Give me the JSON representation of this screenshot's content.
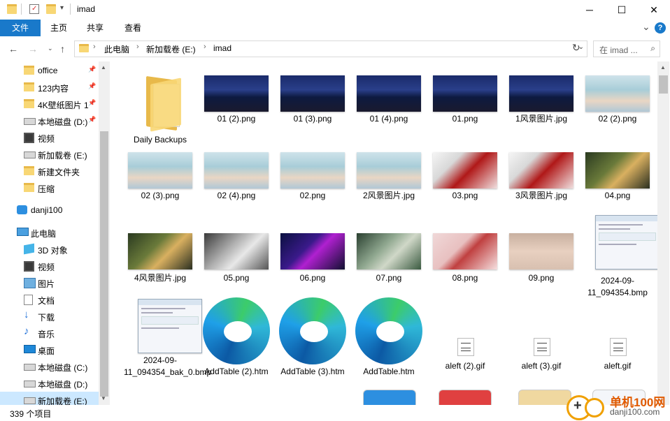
{
  "window": {
    "title": "imad",
    "minimize": "─",
    "maximize": "☐",
    "close": "✕"
  },
  "ribbon": {
    "tabs": [
      "文件",
      "主页",
      "共享",
      "查看"
    ],
    "expand": "⌄",
    "help": "?"
  },
  "address": {
    "crumbs": [
      "此电脑",
      "新加载卷 (E:)",
      "imad"
    ],
    "search_placeholder": "在 imad ...",
    "dropdown": "⌄",
    "refresh": "↻"
  },
  "sidebar": {
    "quick": [
      {
        "label": "office",
        "icon": "folder-icon",
        "pinned": true
      },
      {
        "label": "123内容",
        "icon": "folder-icon",
        "pinned": true
      },
      {
        "label": "4K壁纸图片 1",
        "icon": "folder-icon",
        "pinned": true
      },
      {
        "label": "本地磁盘 (D:)",
        "icon": "drive-icon",
        "pinned": true
      },
      {
        "label": "视频",
        "icon": "video-icon",
        "pinned": false
      },
      {
        "label": "新加载卷 (E:)",
        "icon": "drive-icon",
        "pinned": false
      },
      {
        "label": "新建文件夹",
        "icon": "folder-icon",
        "pinned": false
      },
      {
        "label": "压缩",
        "icon": "folder-icon",
        "pinned": false
      }
    ],
    "onedrive": "danji100",
    "thispc": "此电脑",
    "pc_items": [
      {
        "label": "3D 对象",
        "icon": "3d-objects-icon"
      },
      {
        "label": "视频",
        "icon": "video-icon"
      },
      {
        "label": "图片",
        "icon": "pictures-icon"
      },
      {
        "label": "文档",
        "icon": "documents-icon"
      },
      {
        "label": "下载",
        "icon": "download-icon"
      },
      {
        "label": "音乐",
        "icon": "music-icon"
      },
      {
        "label": "桌面",
        "icon": "desktop-icon"
      },
      {
        "label": "本地磁盘 (C:)",
        "icon": "drive-icon"
      },
      {
        "label": "本地磁盘 (D:)",
        "icon": "drive-icon"
      },
      {
        "label": "新加载卷 (E:)",
        "icon": "drive-icon"
      }
    ]
  },
  "files": [
    {
      "name": "Daily Backups",
      "kind": "folder"
    },
    {
      "name": "01 (2).png",
      "kind": "anime"
    },
    {
      "name": "01 (3).png",
      "kind": "anime"
    },
    {
      "name": "01 (4).png",
      "kind": "anime"
    },
    {
      "name": "01.png",
      "kind": "anime"
    },
    {
      "name": "1风景图片.jpg",
      "kind": "anime"
    },
    {
      "name": "02 (2).png",
      "kind": "beach"
    },
    {
      "name": "02 (3).png",
      "kind": "beach"
    },
    {
      "name": "02 (4).png",
      "kind": "beach"
    },
    {
      "name": "02.png",
      "kind": "beach"
    },
    {
      "name": "2风景图片.jpg",
      "kind": "beach"
    },
    {
      "name": "03.png",
      "kind": "red"
    },
    {
      "name": "3风景图片.jpg",
      "kind": "red"
    },
    {
      "name": "04.png",
      "kind": "forest"
    },
    {
      "name": "4风景图片.jpg",
      "kind": "forest"
    },
    {
      "name": "05.png",
      "kind": "gray"
    },
    {
      "name": "06.png",
      "kind": "purple"
    },
    {
      "name": "07.png",
      "kind": "green"
    },
    {
      "name": "08.png",
      "kind": "pink"
    },
    {
      "name": "09.png",
      "kind": "portrait"
    },
    {
      "name": "2024-09-11_094354.bmp",
      "kind": "screenshot"
    },
    {
      "name": "2024-09-11_094354_bak_0.bmp",
      "kind": "screenshot"
    },
    {
      "name": "AddTable (2).htm",
      "kind": "edge"
    },
    {
      "name": "AddTable (3).htm",
      "kind": "edge"
    },
    {
      "name": "AddTable.htm",
      "kind": "edge"
    },
    {
      "name": "aleft (2).gif",
      "kind": "gif"
    },
    {
      "name": "aleft (3).gif",
      "kind": "gif"
    },
    {
      "name": "aleft.gif",
      "kind": "gif"
    }
  ],
  "status": {
    "count": "339 个项目"
  },
  "watermark": {
    "line1": "单机100网",
    "line2": "danji100.com"
  }
}
